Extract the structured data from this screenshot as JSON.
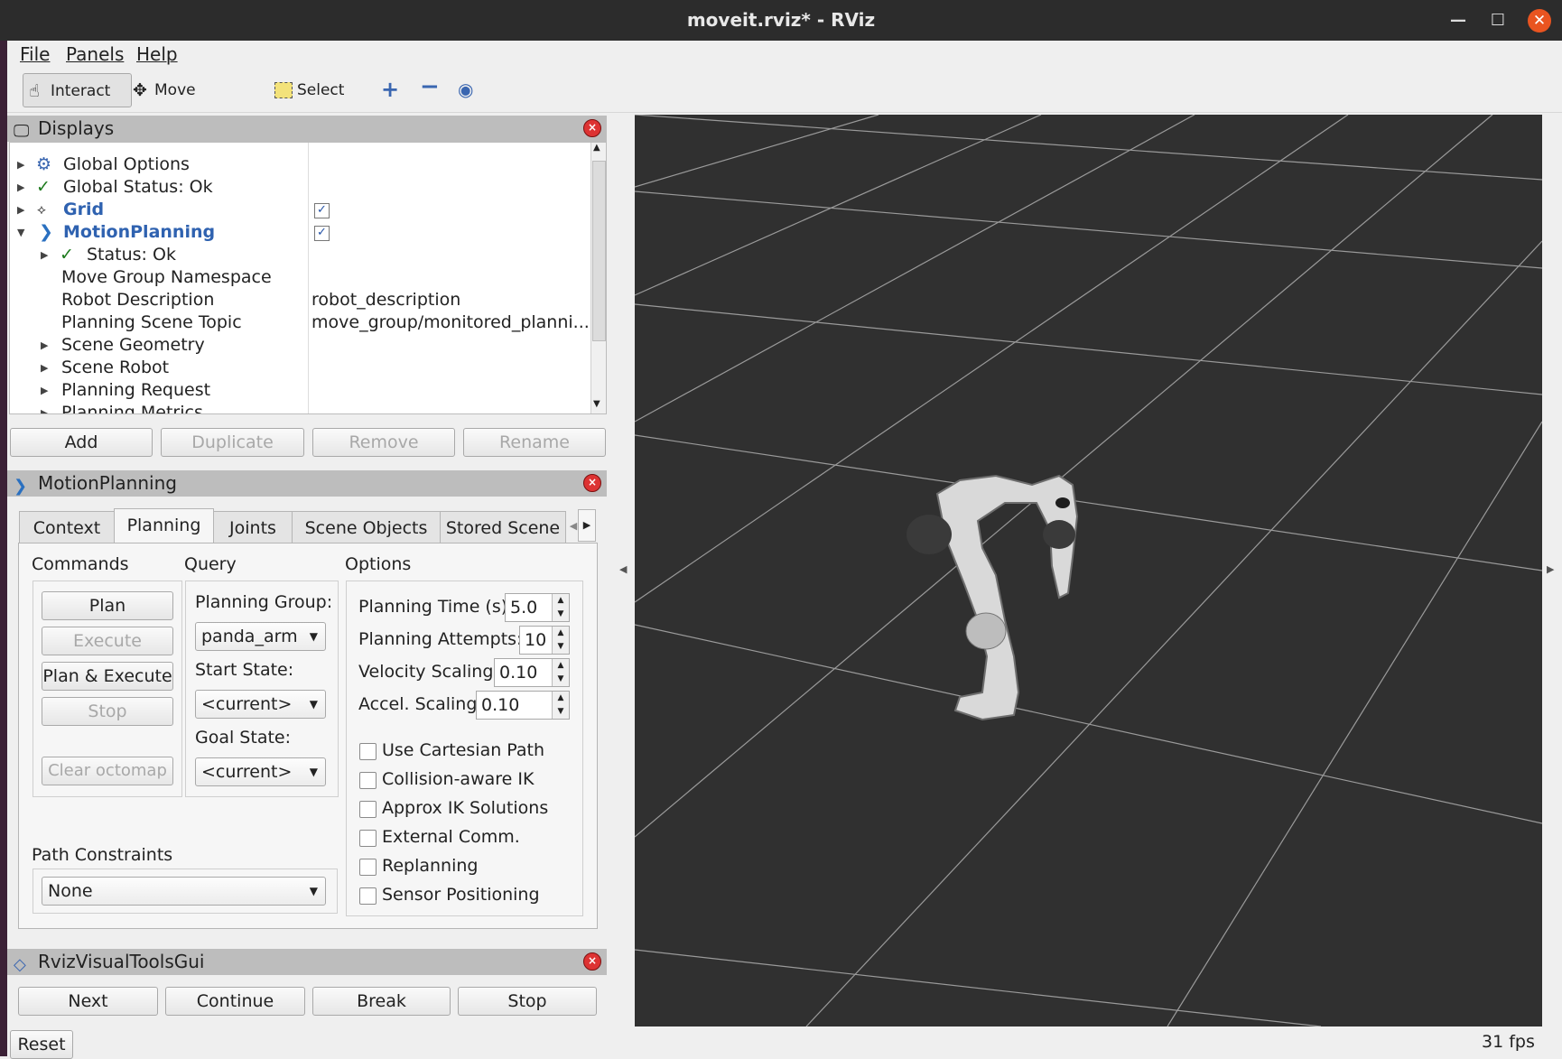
{
  "window": {
    "title": "moveit.rviz* - RViz",
    "minimize_icon": "minimize-icon",
    "maximize_icon": "maximize-icon",
    "close_icon": "close-icon"
  },
  "menubar": {
    "items": [
      "File",
      "Panels",
      "Help"
    ]
  },
  "toolbar": {
    "interact": "Interact",
    "move_camera": "Move Camera",
    "select": "Select"
  },
  "displays": {
    "title": "Displays",
    "items": {
      "global_options": "Global Options",
      "global_status": "Global Status: Ok",
      "grid": "Grid",
      "motion_planning": "MotionPlanning",
      "status": "Status: Ok",
      "move_group_namespace": "Move Group Namespace",
      "robot_description": "Robot Description",
      "robot_description_value": "robot_description",
      "planning_scene_topic": "Planning Scene Topic",
      "planning_scene_topic_value": "move_group/monitored_planni...",
      "scene_geometry": "Scene Geometry",
      "scene_robot": "Scene Robot",
      "planning_request": "Planning Request",
      "planning_metrics": "Planning Metrics"
    },
    "buttons": {
      "add": "Add",
      "duplicate": "Duplicate",
      "remove": "Remove",
      "rename": "Rename"
    }
  },
  "motion_planning": {
    "title": "MotionPlanning",
    "tabs": [
      "Context",
      "Planning",
      "Joints",
      "Scene Objects",
      "Stored Scene"
    ],
    "commands": {
      "heading": "Commands",
      "plan": "Plan",
      "execute": "Execute",
      "plan_execute": "Plan & Execute",
      "stop": "Stop",
      "clear_octomap": "Clear octomap"
    },
    "query": {
      "heading": "Query",
      "planning_group_label": "Planning Group:",
      "planning_group": "panda_arm",
      "start_state_label": "Start State:",
      "start_state": "<current>",
      "goal_state_label": "Goal State:",
      "goal_state": "<current>"
    },
    "options": {
      "heading": "Options",
      "planning_time_label": "Planning Time (s):",
      "planning_time": "5.0",
      "planning_attempts_label": "Planning Attempts:",
      "planning_attempts": "10",
      "velocity_scaling_label": "Velocity Scaling:",
      "velocity_scaling": "0.10",
      "accel_scaling_label": "Accel. Scaling:",
      "accel_scaling": "0.10",
      "checkboxes": [
        "Use Cartesian Path",
        "Collision-aware IK",
        "Approx IK Solutions",
        "External Comm.",
        "Replanning",
        "Sensor Positioning"
      ]
    },
    "path_constraints": {
      "label": "Path Constraints",
      "value": "None"
    }
  },
  "visual_tools": {
    "title": "RvizVisualToolsGui",
    "next": "Next",
    "continue": "Continue",
    "break": "Break",
    "stop": "Stop"
  },
  "reset": "Reset",
  "fps": "31 fps"
}
